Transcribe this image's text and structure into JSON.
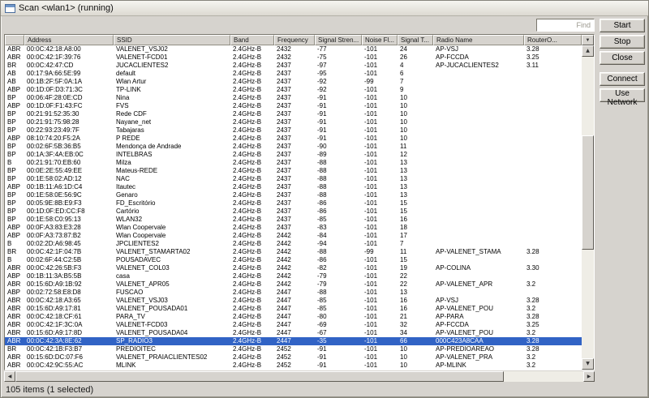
{
  "window": {
    "title": "Scan <wlan1> (running)"
  },
  "find": {
    "placeholder": "Find"
  },
  "actions": {
    "start": "Start",
    "stop": "Stop",
    "close": "Close",
    "connect": "Connect",
    "use_network": "Use Network"
  },
  "table": {
    "columns": [
      "Address",
      "SSID",
      "Band",
      "Frequency",
      "Signal Stren...",
      "Noise Fl...",
      "Signal T...",
      "Radio Name",
      "RouterO..."
    ],
    "selected_row_index": 36,
    "rows": [
      [
        "ABR",
        "00:0C:42:18:A8:00",
        "VALENET_VSJ02",
        "2.4GHz-B",
        "2432",
        "-77",
        "-101",
        "24",
        "AP-VSJ",
        "3.28"
      ],
      [
        "ABR",
        "00:0C:42:1F:39:76",
        "VALENET-FCD01",
        "2.4GHz-B",
        "2432",
        "-75",
        "-101",
        "26",
        "AP-FCCDA",
        "3.25"
      ],
      [
        "BR",
        "00:0C:42:47:CD",
        "JUCACLIENTES2",
        "2.4GHz-B",
        "2437",
        "-97",
        "-101",
        "4",
        "AP-JUCACLIENTES2",
        "3.11"
      ],
      [
        "AB",
        "00:17:9A:66:5E:99",
        "default",
        "2.4GHz-B",
        "2437",
        "-95",
        "-101",
        "6",
        "",
        ""
      ],
      [
        "AB",
        "00:1B:2F:5F:0A:1A",
        "Wlan Artur",
        "2.4GHz-B",
        "2437",
        "-92",
        "-99",
        "7",
        "",
        ""
      ],
      [
        "ABP",
        "00:1D:0F:D3:71:3C",
        "TP-LINK",
        "2.4GHz-B",
        "2437",
        "-92",
        "-101",
        "9",
        "",
        ""
      ],
      [
        "BP",
        "00:06:4F:28:0E:CD",
        "Nina",
        "2.4GHz-B",
        "2437",
        "-91",
        "-101",
        "10",
        "",
        ""
      ],
      [
        "ABP",
        "00:1D:0F:F1:43:FC",
        "FVS",
        "2.4GHz-B",
        "2437",
        "-91",
        "-101",
        "10",
        "",
        ""
      ],
      [
        "BP",
        "00:21:91:52:35:30",
        "Rede CDF",
        "2.4GHz-B",
        "2437",
        "-91",
        "-101",
        "10",
        "",
        ""
      ],
      [
        "BP",
        "00:21:91:75:98:28",
        "Nayane_net",
        "2.4GHz-B",
        "2437",
        "-91",
        "-101",
        "10",
        "",
        ""
      ],
      [
        "BP",
        "00:22:93:23:49:7F",
        "Tabajaras",
        "2.4GHz-B",
        "2437",
        "-91",
        "-101",
        "10",
        "",
        ""
      ],
      [
        "ABP",
        "08:10:74:20:F5:2A",
        "P REDE",
        "2.4GHz-B",
        "2437",
        "-91",
        "-101",
        "10",
        "",
        ""
      ],
      [
        "BP",
        "00:02:6F:5B:36:B5",
        "Mendonça de Andrade",
        "2.4GHz-B",
        "2437",
        "-90",
        "-101",
        "11",
        "",
        ""
      ],
      [
        "BP",
        "00:1A:3F:4A:EB:0C",
        "INTELBRAS",
        "2.4GHz-B",
        "2437",
        "-89",
        "-101",
        "12",
        "",
        ""
      ],
      [
        "B",
        "00:21:91:70:EB:60",
        "Milza",
        "2.4GHz-B",
        "2437",
        "-88",
        "-101",
        "13",
        "",
        ""
      ],
      [
        "BP",
        "00:0E:2E:55:49:EE",
        "Mateus-REDE",
        "2.4GHz-B",
        "2437",
        "-88",
        "-101",
        "13",
        "",
        ""
      ],
      [
        "BP",
        "00:1E:58:02:AD:12",
        "NAC",
        "2.4GHz-B",
        "2437",
        "-88",
        "-101",
        "13",
        "",
        ""
      ],
      [
        "ABP",
        "00:1B:11:A6:1D:C4",
        "Itautec",
        "2.4GHz-B",
        "2437",
        "-88",
        "-101",
        "13",
        "",
        ""
      ],
      [
        "BP",
        "00:1E:58:0E:56:9C",
        "Genaro",
        "2.4GHz-B",
        "2437",
        "-88",
        "-101",
        "13",
        "",
        ""
      ],
      [
        "BP",
        "00:05:9E:8B:E9:F3",
        "FD_Escritório",
        "2.4GHz-B",
        "2437",
        "-86",
        "-101",
        "15",
        "",
        ""
      ],
      [
        "BP",
        "00:1D:0F:ED:CC:F8",
        "Cartório",
        "2.4GHz-B",
        "2437",
        "-86",
        "-101",
        "15",
        "",
        ""
      ],
      [
        "BP",
        "00:1E:58:C0:95:13",
        "WLAN32",
        "2.4GHz-B",
        "2437",
        "-85",
        "-101",
        "16",
        "",
        ""
      ],
      [
        "ABP",
        "00:0F:A3:83:E3:28",
        "Wlan Coopervale",
        "2.4GHz-B",
        "2437",
        "-83",
        "-101",
        "18",
        "",
        ""
      ],
      [
        "ABP",
        "00:0F:A3:73:87:B2",
        "Wlan Coopervale",
        "2.4GHz-B",
        "2442",
        "-84",
        "-101",
        "17",
        "",
        ""
      ],
      [
        "B",
        "00:02:2D:A6:98:45",
        "JPCLIENTES2",
        "2.4GHz-B",
        "2442",
        "-94",
        "-101",
        "7",
        "",
        ""
      ],
      [
        "BR",
        "00:0C:42:1F:04:7B",
        "VALENET_STAMARTA02",
        "2.4GHz-B",
        "2442",
        "-88",
        "-99",
        "11",
        "AP-VALENET_STAMA",
        "3.28"
      ],
      [
        "B",
        "00:02:6F:44:C2:5B",
        "POUSADAVEC",
        "2.4GHz-B",
        "2442",
        "-86",
        "-101",
        "15",
        "",
        ""
      ],
      [
        "ABR",
        "00:0C:42:26:5B:F3",
        "VALENET_COL03",
        "2.4GHz-B",
        "2442",
        "-82",
        "-101",
        "19",
        "AP-COLINA",
        "3.30"
      ],
      [
        "ABP",
        "00:1B:11:3A:B5:5B",
        "casa",
        "2.4GHz-B",
        "2442",
        "-79",
        "-101",
        "22",
        "",
        ""
      ],
      [
        "ABR",
        "00:15:6D:A9:1B:92",
        "VALENET_APR05",
        "2.4GHz-B",
        "2442",
        "-79",
        "-101",
        "22",
        "AP-VALENET_APR",
        "3.2"
      ],
      [
        "ABP",
        "00:02:72:58:E8:D8",
        "FUSCAO",
        "2.4GHz-B",
        "2447",
        "-88",
        "-101",
        "13",
        "",
        ""
      ],
      [
        "ABR",
        "00:0C:42:18:A3:65",
        "VALENET_VSJ03",
        "2.4GHz-B",
        "2447",
        "-85",
        "-101",
        "16",
        "AP-VSJ",
        "3.28"
      ],
      [
        "ABR",
        "00:15:6D:A9:17:81",
        "VALENET_POUSADA01",
        "2.4GHz-B",
        "2447",
        "-85",
        "-101",
        "16",
        "AP-VALENET_POU",
        "3.2"
      ],
      [
        "ABR",
        "00:0C:42:18:CF:61",
        "PARA_TV",
        "2.4GHz-B",
        "2447",
        "-80",
        "-101",
        "21",
        "AP-PARA",
        "3.28"
      ],
      [
        "ABR",
        "00:0C:42:1F:3C:0A",
        "VALENET-FCD03",
        "2.4GHz-B",
        "2447",
        "-69",
        "-101",
        "32",
        "AP-FCCDA",
        "3.25"
      ],
      [
        "ABR",
        "00:15:6D:A9:17:8D",
        "VALENET_POUSADA04",
        "2.4GHz-B",
        "2447",
        "-67",
        "-101",
        "34",
        "AP-VALENET_POU",
        "3.2"
      ],
      [
        "ABR",
        "00:0C:42:3A:8E:62",
        "SP_RADIO3",
        "2.4GHz-B",
        "2447",
        "-35",
        "-101",
        "66",
        "000C423A8CAA",
        "3.28"
      ],
      [
        "BR",
        "00:0C:42:1B:F3:B7",
        "PREDIOITEC",
        "2.4GHz-B",
        "2452",
        "-91",
        "-101",
        "10",
        "AP-PREDIOAREAO",
        "3.28"
      ],
      [
        "ABR",
        "00:15:6D:DC:07:F6",
        "VALENET_PRAIACLIENTES02",
        "2.4GHz-B",
        "2452",
        "-91",
        "-101",
        "10",
        "AP-VALENET_PRA",
        "3.2"
      ],
      [
        "ABR",
        "00:0C:42:9C:55:AC",
        "MLINK",
        "2.4GHz-B",
        "2452",
        "-91",
        "-101",
        "10",
        "AP-MLINK",
        "3.2"
      ]
    ]
  },
  "status": {
    "text": "105 items (1 selected)"
  },
  "colors": {
    "selection": "#3163c5"
  },
  "icons": {
    "column_config": "▼",
    "scroll_up": "▲",
    "scroll_down": "▼",
    "scroll_left": "◀",
    "scroll_right": "▶"
  }
}
